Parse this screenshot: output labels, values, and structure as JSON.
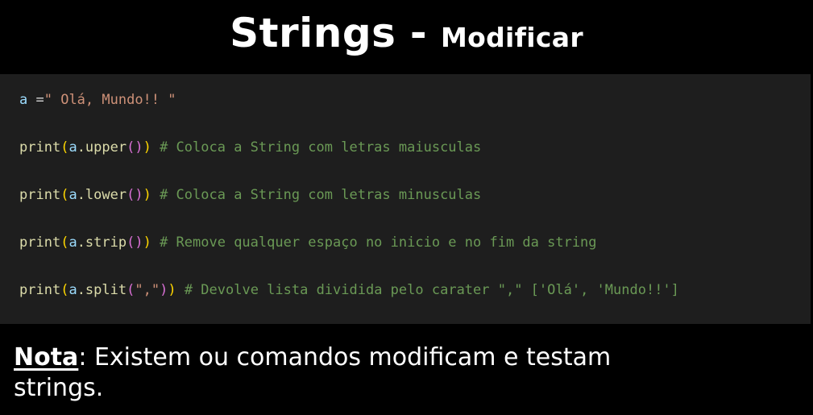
{
  "title": {
    "main": "Strings",
    "separator": " - ",
    "sub": "Modificar"
  },
  "code": {
    "line1": {
      "var": "a",
      "op": " =",
      "str": "\" Olá, Mundo!! \""
    },
    "line2": {
      "fn": "print",
      "open": "(",
      "obj": "a",
      "method": ".upper",
      "inner": "()",
      "close": ")",
      "comment": " # Coloca a String com letras maiusculas"
    },
    "line3": {
      "fn": "print",
      "open": "(",
      "obj": "a",
      "method": ".lower",
      "inner": "()",
      "close": ")",
      "comment": " # Coloca a String com letras minusculas"
    },
    "line4": {
      "fn": "print",
      "open": "(",
      "obj": "a",
      "method": ".strip",
      "inner": "()",
      "close": ")",
      "comment": " # Remove qualquer espaço no inicio e no fim da string"
    },
    "line5": {
      "fn": "print",
      "open": "(",
      "obj": "a",
      "method": ".split",
      "inner_open": "(",
      "arg": "\",\"",
      "inner_close": ")",
      "close": ")",
      "comment": " # Devolve lista dividida pelo carater \",\" ['Olá', 'Mundo!!']"
    }
  },
  "note": {
    "label": "Nota",
    "text": ": Existem ou comandos modificam e testam strings."
  },
  "colors": {
    "background": "#000000",
    "code_background": "#1e1e1e",
    "variable": "#9cdcfe",
    "string": "#ce9178",
    "function": "#dcdcaa",
    "bracket": "#ffd700",
    "bracket_nested": "#da70d6",
    "comment": "#6a9955"
  }
}
